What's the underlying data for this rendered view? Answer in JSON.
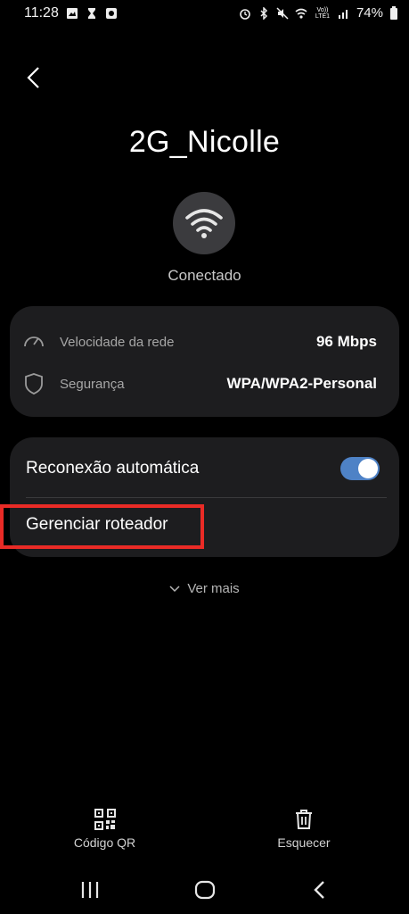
{
  "status_bar": {
    "time": "11:28",
    "battery": "74%",
    "volte": "Vo)) LTE1"
  },
  "header": {
    "network_name": "2G_Nicolle",
    "connection_status": "Conectado"
  },
  "network_info": {
    "speed_label": "Velocidade da rede",
    "speed_value": "96 Mbps",
    "security_label": "Segurança",
    "security_value": "WPA/WPA2-Personal"
  },
  "settings": {
    "auto_reconnect_label": "Reconexão automática",
    "auto_reconnect_on": true,
    "manage_router_label": "Gerenciar roteador"
  },
  "more": {
    "label": "Ver mais"
  },
  "actions": {
    "qr_label": "Código QR",
    "forget_label": "Esquecer"
  },
  "colors": {
    "accent": "#4e82c6",
    "highlight": "#ea2b26",
    "card": "#1d1d1f"
  }
}
